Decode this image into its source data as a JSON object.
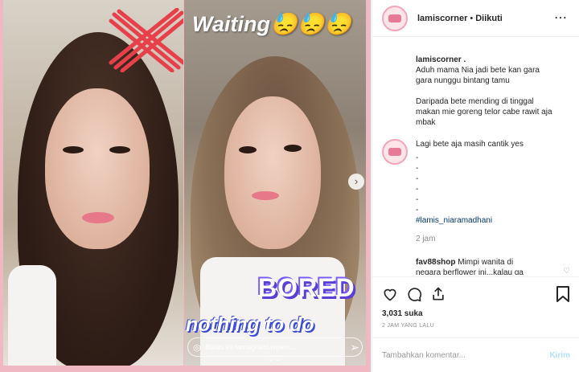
{
  "post": {
    "username": "lamiscorner",
    "separator": "•",
    "follow_status": "Diikuti",
    "more_icon": "⋯"
  },
  "media": {
    "story_text_waiting": "Waiting😓😓😓",
    "story_sticker_bored": "BORED",
    "story_sticker_nothing": "nothing to do",
    "story_reply_placeholder": "Balas ke lamaghanl.mpen...",
    "story_page_dots": "• •",
    "next_arrow_icon": "›",
    "cross_color": "#e8404a",
    "border_color": "#f0b9c2"
  },
  "caption": {
    "username": "lamiscorner .",
    "lines": [
      "Aduh mama Nia jadi bete kan gara",
      "gara nunggu bintang tamu",
      "",
      "Daripada bete mending di tinggal",
      "makan mie goreng telor cabe rawit aja",
      "mbak"
    ]
  },
  "reply_comment": {
    "lines": [
      "Lagi bete aja masih cantik yes",
      "-",
      "-",
      "-",
      "-",
      "-",
      "-"
    ],
    "hashtag": "#lamis_niaramadhani",
    "time": "2 jam"
  },
  "next_comment": {
    "username": "fav88shop",
    "text": "Mimpi wanita di",
    "text2": "negara berflower ini...kalau ga"
  },
  "actions": {
    "likes": "3,031 suka",
    "date": "2 JAM YANG LALU"
  },
  "comment_input": {
    "placeholder": "Tambahkan komentar...",
    "post_label": "Kirim"
  }
}
